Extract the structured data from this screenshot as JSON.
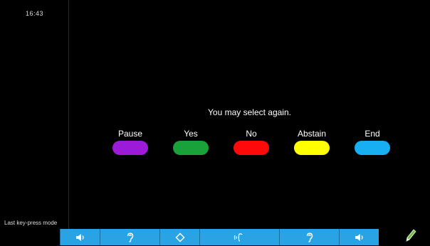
{
  "status": {
    "clock": "16:43",
    "mode": "Last key-press mode"
  },
  "main": {
    "prompt": "You may select again.",
    "options": [
      {
        "label": "Pause",
        "color": "#9b1bd9"
      },
      {
        "label": "Yes",
        "color": "#1aa23a"
      },
      {
        "label": "No",
        "color": "#ff0a0a"
      },
      {
        "label": "Abstain",
        "color": "#ffff00"
      },
      {
        "label": "End",
        "color": "#18aff2"
      }
    ]
  },
  "toolbar": {
    "buttons": [
      {
        "icon": "volume-down-icon"
      },
      {
        "icon": "hearing-icon"
      },
      {
        "icon": "diamond-icon"
      },
      {
        "icon": "voice-icon"
      },
      {
        "icon": "hearing-icon"
      },
      {
        "icon": "volume-up-icon"
      },
      {
        "icon": "pen-icon"
      }
    ],
    "accent": "#29a3e3"
  }
}
